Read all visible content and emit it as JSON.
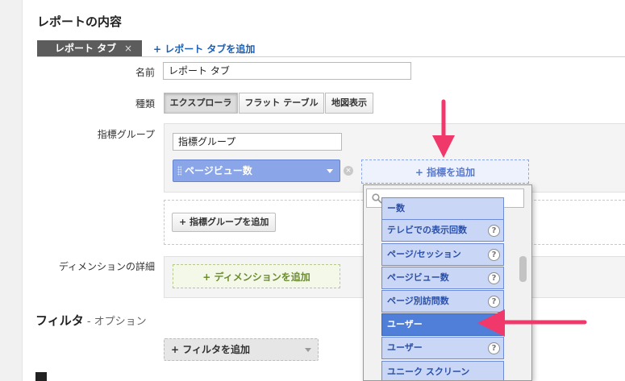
{
  "section": {
    "title": "レポートの内容"
  },
  "tabs": {
    "active_label": "レポート タブ",
    "close_glyph": "×",
    "add_label": "+ レポート タブを追加"
  },
  "name_row": {
    "label": "名前",
    "value": "レポート タブ"
  },
  "type_row": {
    "label": "種類",
    "options": [
      "エクスプローラ",
      "フラット テーブル",
      "地図表示"
    ],
    "selected": "エクスプローラ"
  },
  "metric_group": {
    "label": "指標グループ",
    "name_value": "指標グループ",
    "metric_chip": "ページビュー数",
    "clear_glyph": "×",
    "add_metric_label": "+ 指標を追加",
    "add_group_label": "+ 指標グループを追加"
  },
  "dropdown": {
    "search_icon": "search-icon",
    "options": [
      {
        "label": "ー数",
        "help": ""
      },
      {
        "label": "テレビでの表示回数",
        "help": "?"
      },
      {
        "label": "ページ/セッション",
        "help": "?"
      },
      {
        "label": "ページビュー数",
        "help": "?"
      },
      {
        "label": "ページ別訪問数",
        "help": "?"
      },
      {
        "label": "ユーザー",
        "help": ""
      },
      {
        "label": "ユーザー",
        "help": "?"
      },
      {
        "label": "ユニーク スクリーン",
        "help": ""
      }
    ],
    "selected_index": 5
  },
  "dimension_row": {
    "label": "ディメンションの詳細",
    "add_label": "+ ディメンションを追加"
  },
  "filter": {
    "title": "フィルタ",
    "subtitle": " - オプション",
    "add_label": "+ フィルタを追加"
  },
  "colors": {
    "arrow": "#f0386b",
    "chip": "#8aa5e8",
    "selected_option": "#4f7fd9"
  }
}
